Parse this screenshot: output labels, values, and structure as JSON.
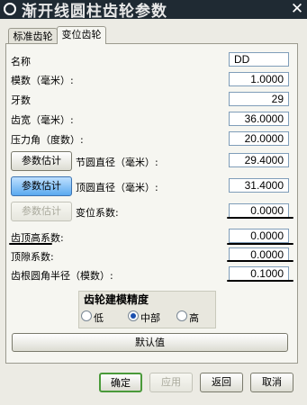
{
  "window": {
    "title": "渐开线圆柱齿轮参数",
    "close_label": "✕"
  },
  "tabs": [
    {
      "label": "标准齿轮",
      "active": false
    },
    {
      "label": "变位齿轮",
      "active": true
    }
  ],
  "form": {
    "name": {
      "label": "名称",
      "value": "DD"
    },
    "module": {
      "label": "模数（毫米）:",
      "value": "1.0000"
    },
    "teeth": {
      "label": "牙数",
      "value": "29"
    },
    "face_width": {
      "label": "齿宽（毫米）:",
      "value": "36.0000"
    },
    "pressure_angle": {
      "label": "压力角（度数）:",
      "value": "20.0000"
    },
    "pitch_diameter": {
      "label": "节圆直径（毫米）:",
      "value": "29.4000",
      "button": "参数估计"
    },
    "tip_diameter": {
      "label": "顶圆直径（毫米）:",
      "value": "31.4000",
      "button": "参数估计"
    },
    "shift_coef": {
      "label": "变位系数:",
      "value": "0.0000",
      "button": "参数估计"
    },
    "addendum_coef": {
      "label": "齿顶高系数:",
      "value": "0.0000"
    },
    "clearance_coef": {
      "label": "顶隙系数:",
      "value": "0.0000"
    },
    "root_fillet": {
      "label": "齿根圆角半径（模数）:",
      "value": "0.1000"
    }
  },
  "precision": {
    "title": "齿轮建模精度",
    "options": [
      "低",
      "中部",
      "高"
    ],
    "selected": "中部"
  },
  "default_button": "默认值",
  "footer": {
    "ok": "确定",
    "apply": "应用",
    "back": "返回",
    "cancel": "取消"
  }
}
